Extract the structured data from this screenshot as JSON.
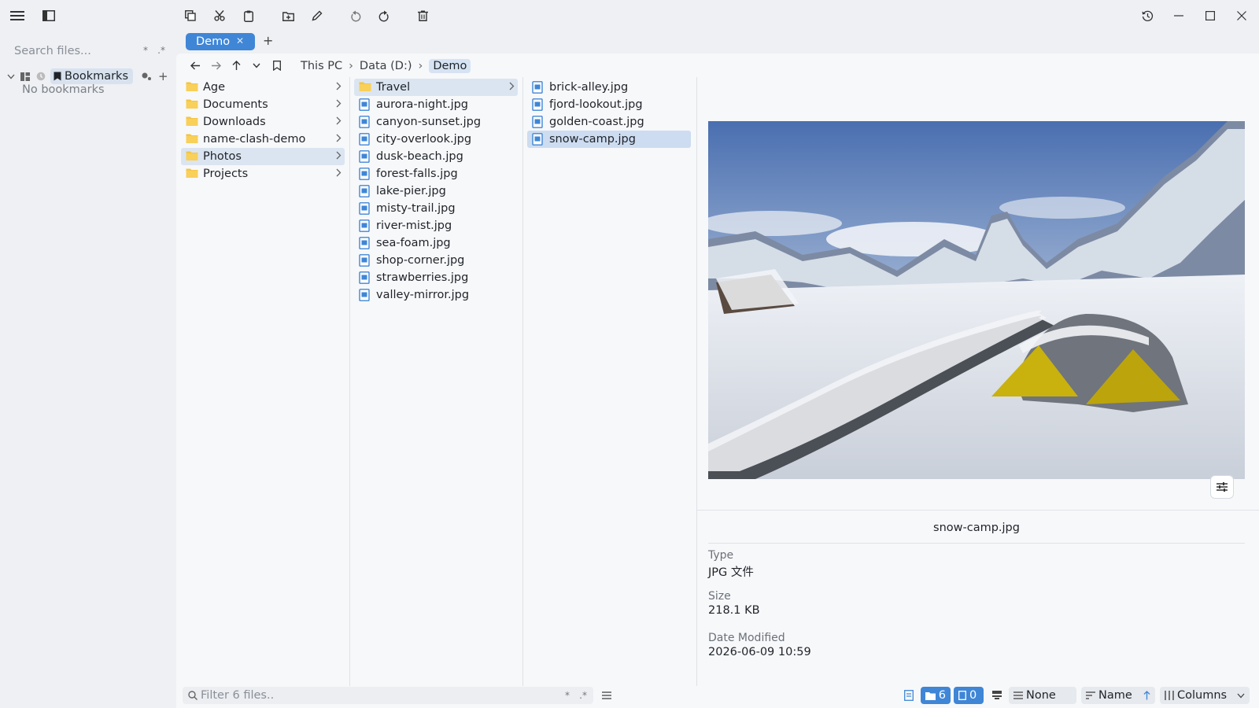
{
  "toolbar": {
    "icons": [
      "hamburger-icon",
      "sidebar-toggle-icon",
      "copy-icon",
      "cut-icon",
      "paste-icon",
      "new-folder-icon",
      "rename-icon",
      "undo-icon",
      "redo-icon",
      "delete-icon",
      "history-icon",
      "minimize-icon",
      "maximize-icon",
      "close-icon"
    ]
  },
  "sidebar": {
    "search_placeholder": "Search files...",
    "search_opt_glob": "*",
    "search_opt_regex": ".*",
    "bookmarks_label": "Bookmarks",
    "add_symbol": "+",
    "empty_text": "No bookmarks"
  },
  "tabs": [
    {
      "label": "Demo",
      "close": "✕"
    }
  ],
  "tab_add": "+",
  "breadcrumb": [
    "This PC",
    "Data (D:)",
    "Demo"
  ],
  "breadcrumb_sep": "›",
  "columns": {
    "col1": [
      {
        "name": "Age",
        "type": "folder"
      },
      {
        "name": "Documents",
        "type": "folder"
      },
      {
        "name": "Downloads",
        "type": "folder"
      },
      {
        "name": "name-clash-demo",
        "type": "folder"
      },
      {
        "name": "Photos",
        "type": "folder",
        "selected": true
      },
      {
        "name": "Projects",
        "type": "folder"
      }
    ],
    "col2": [
      {
        "name": "Travel",
        "type": "folder",
        "selected": true
      },
      {
        "name": "aurora-night.jpg",
        "type": "file"
      },
      {
        "name": "canyon-sunset.jpg",
        "type": "file"
      },
      {
        "name": "city-overlook.jpg",
        "type": "file"
      },
      {
        "name": "dusk-beach.jpg",
        "type": "file"
      },
      {
        "name": "forest-falls.jpg",
        "type": "file"
      },
      {
        "name": "lake-pier.jpg",
        "type": "file"
      },
      {
        "name": "misty-trail.jpg",
        "type": "file"
      },
      {
        "name": "river-mist.jpg",
        "type": "file"
      },
      {
        "name": "sea-foam.jpg",
        "type": "file"
      },
      {
        "name": "shop-corner.jpg",
        "type": "file"
      },
      {
        "name": "strawberries.jpg",
        "type": "file"
      },
      {
        "name": "valley-mirror.jpg",
        "type": "file"
      }
    ],
    "col3": [
      {
        "name": "brick-alley.jpg",
        "type": "file"
      },
      {
        "name": "fjord-lookout.jpg",
        "type": "file"
      },
      {
        "name": "golden-coast.jpg",
        "type": "file"
      },
      {
        "name": "snow-camp.jpg",
        "type": "file",
        "selected": true
      }
    ]
  },
  "preview": {
    "filename": "snow-camp.jpg",
    "type_label": "Type",
    "type_value": "JPG 文件",
    "size_label": "Size",
    "size_value": "218.1 KB",
    "date_label": "Date Modified",
    "date_value": "2026-06-09 10:59"
  },
  "statusbar": {
    "filter_placeholder": "Filter 6 files..",
    "filter_opt_glob": "*",
    "filter_opt_regex": ".*",
    "folder_count": "6",
    "file_count": "0",
    "group_label": "None",
    "sort_label": "Name",
    "view_label": "Columns"
  },
  "colors": {
    "accent": "#3f86d6",
    "selection": "#dbe5f1",
    "folder": "#f5c542",
    "file": "#3f86d6"
  }
}
